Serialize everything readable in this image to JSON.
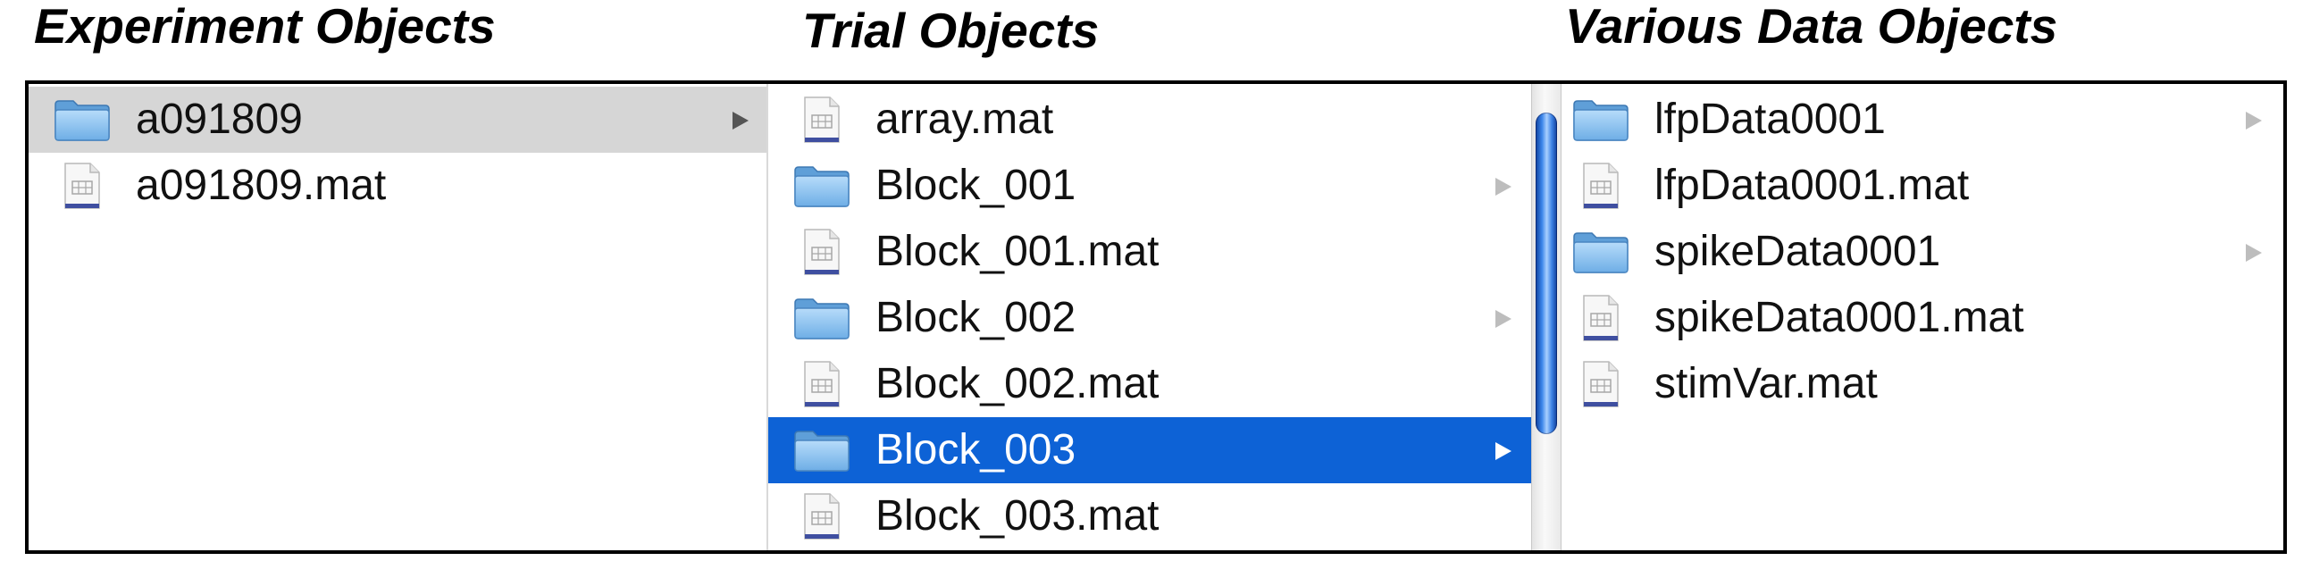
{
  "headings": {
    "experiment": "Experiment Objects",
    "trial": "Trial Objects",
    "various": "Various Data Objects"
  },
  "columns": {
    "experiment": [
      {
        "label": "a091809",
        "icon": "folder-icon",
        "selected": "inactive",
        "has_children": true
      },
      {
        "label": "a091809.mat",
        "icon": "mat-file-icon",
        "selected": "none",
        "has_children": false
      }
    ],
    "trial": [
      {
        "label": "array.mat",
        "icon": "mat-file-icon",
        "selected": "none",
        "has_children": false
      },
      {
        "label": "Block_001",
        "icon": "folder-icon",
        "selected": "none",
        "has_children": true
      },
      {
        "label": "Block_001.mat",
        "icon": "mat-file-icon",
        "selected": "none",
        "has_children": false
      },
      {
        "label": "Block_002",
        "icon": "folder-icon",
        "selected": "none",
        "has_children": true
      },
      {
        "label": "Block_002.mat",
        "icon": "mat-file-icon",
        "selected": "none",
        "has_children": false
      },
      {
        "label": "Block_003",
        "icon": "folder-icon",
        "selected": "active",
        "has_children": true
      },
      {
        "label": "Block_003.mat",
        "icon": "mat-file-icon",
        "selected": "none",
        "has_children": false
      }
    ],
    "various": [
      {
        "label": "lfpData0001",
        "icon": "folder-icon",
        "selected": "none",
        "has_children": true
      },
      {
        "label": "lfpData0001.mat",
        "icon": "mat-file-icon",
        "selected": "none",
        "has_children": false
      },
      {
        "label": "spikeData0001",
        "icon": "folder-icon",
        "selected": "none",
        "has_children": true
      },
      {
        "label": "spikeData0001.mat",
        "icon": "mat-file-icon",
        "selected": "none",
        "has_children": false
      },
      {
        "label": "stimVar.mat",
        "icon": "mat-file-icon",
        "selected": "none",
        "has_children": false
      }
    ]
  },
  "colors": {
    "selection_active": "#0d62d6",
    "selection_inactive": "#d6d6d6",
    "folder_body": "#7fb8e8",
    "scroll_thumb": "#3c86ea"
  }
}
